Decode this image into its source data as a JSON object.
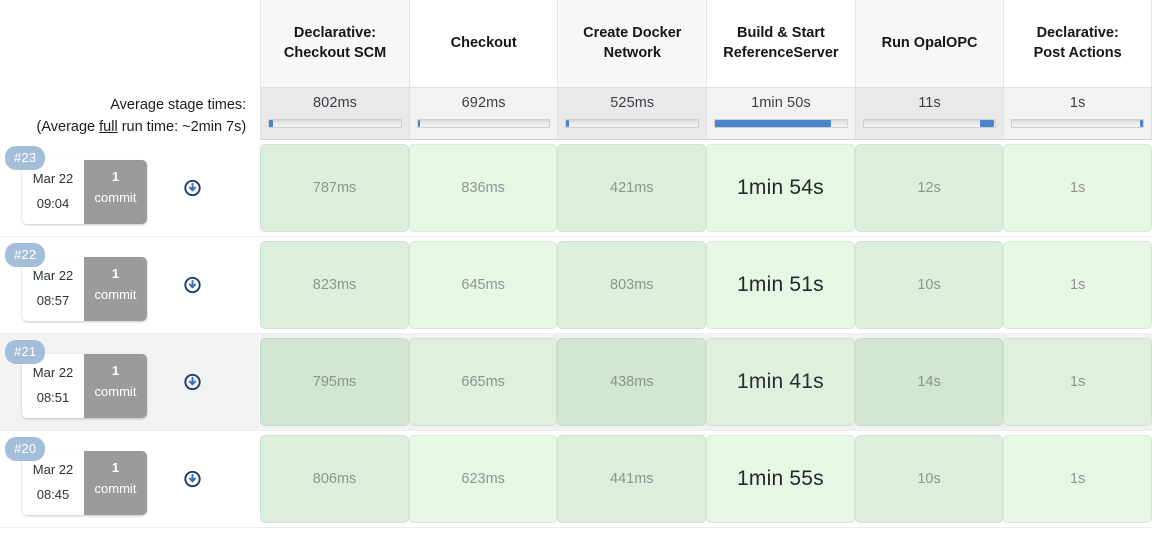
{
  "theme": {
    "badge_blue": "#a4bed9",
    "progress_blue": "#4a84cf",
    "commit_gray": "#9b9b9b",
    "cell_green": "#dcefdc",
    "cell_green_light": "#e6f7e3",
    "cell_green_hover": "#d2e7d2",
    "header_gray": "#f7f7f7",
    "avg_row_gray": "#e9e9e9"
  },
  "average": {
    "label_line1": "Average stage times:",
    "label_line2_pre": "(Average ",
    "label_line2_underlined": "full",
    "label_line2_post": " run time: ~2min 7s)"
  },
  "stages": [
    {
      "name": "Declarative: Checkout SCM",
      "name_line1": "Declarative:",
      "name_line2": "Checkout SCM",
      "average": "802ms",
      "bar_start_pct": 0,
      "bar_width_pct": 2.5,
      "header_alt": false
    },
    {
      "name": "Checkout",
      "name_line1": "Checkout",
      "name_line2": "",
      "average": "692ms",
      "bar_start_pct": 0,
      "bar_width_pct": 2.0,
      "header_alt": true
    },
    {
      "name": "Create Docker Network",
      "name_line1": "Create Docker",
      "name_line2": "Network",
      "average": "525ms",
      "bar_start_pct": 0,
      "bar_width_pct": 1.6,
      "header_alt": false
    },
    {
      "name": "Build & Start ReferenceServer",
      "name_line1": "Build & Start",
      "name_line2": "ReferenceServer",
      "average": "1min 50s",
      "bar_start_pct": 0,
      "bar_width_pct": 88,
      "header_alt": true
    },
    {
      "name": "Run OpalOPC",
      "name_line1": "Run OpalOPC",
      "name_line2": "",
      "average": "11s",
      "bar_start_pct": 88,
      "bar_width_pct": 11,
      "header_alt": false
    },
    {
      "name": "Declarative: Post Actions",
      "name_line1": "Declarative:",
      "name_line2": "Post Actions",
      "average": "1s",
      "bar_start_pct": 97.5,
      "bar_width_pct": 2.2,
      "header_alt": true
    }
  ],
  "builds": [
    {
      "number": "#23",
      "date": "Mar 22",
      "time": "09:04",
      "commit_count": "1",
      "commit_label": "commit",
      "history_icon": "download-circle-icon",
      "highlighted": false,
      "cells": [
        {
          "duration": "787ms",
          "big": false,
          "shade": "mid"
        },
        {
          "duration": "836ms",
          "big": false,
          "shade": "light"
        },
        {
          "duration": "421ms",
          "big": false,
          "shade": "mid"
        },
        {
          "duration": "1min 54s",
          "big": true,
          "shade": "light"
        },
        {
          "duration": "12s",
          "big": false,
          "shade": "mid"
        },
        {
          "duration": "1s",
          "big": false,
          "shade": "light"
        }
      ]
    },
    {
      "number": "#22",
      "date": "Mar 22",
      "time": "08:57",
      "commit_count": "1",
      "commit_label": "commit",
      "history_icon": "download-circle-icon",
      "highlighted": false,
      "cells": [
        {
          "duration": "823ms",
          "big": false,
          "shade": "mid"
        },
        {
          "duration": "645ms",
          "big": false,
          "shade": "light"
        },
        {
          "duration": "803ms",
          "big": false,
          "shade": "mid"
        },
        {
          "duration": "1min 51s",
          "big": true,
          "shade": "light"
        },
        {
          "duration": "10s",
          "big": false,
          "shade": "mid"
        },
        {
          "duration": "1s",
          "big": false,
          "shade": "light"
        }
      ]
    },
    {
      "number": "#21",
      "date": "Mar 22",
      "time": "08:51",
      "commit_count": "1",
      "commit_label": "commit",
      "history_icon": "download-circle-icon",
      "highlighted": true,
      "cells": [
        {
          "duration": "795ms",
          "big": false,
          "shade": "hover"
        },
        {
          "duration": "665ms",
          "big": false,
          "shade": "hoverlight"
        },
        {
          "duration": "438ms",
          "big": false,
          "shade": "hover"
        },
        {
          "duration": "1min 41s",
          "big": true,
          "shade": "hoverlight"
        },
        {
          "duration": "14s",
          "big": false,
          "shade": "hover"
        },
        {
          "duration": "1s",
          "big": false,
          "shade": "hoverlight"
        }
      ]
    },
    {
      "number": "#20",
      "date": "Mar 22",
      "time": "08:45",
      "commit_count": "1",
      "commit_label": "commit",
      "history_icon": "download-circle-icon",
      "highlighted": false,
      "cells": [
        {
          "duration": "806ms",
          "big": false,
          "shade": "mid"
        },
        {
          "duration": "623ms",
          "big": false,
          "shade": "light"
        },
        {
          "duration": "441ms",
          "big": false,
          "shade": "mid"
        },
        {
          "duration": "1min 55s",
          "big": true,
          "shade": "light"
        },
        {
          "duration": "10s",
          "big": false,
          "shade": "mid"
        },
        {
          "duration": "1s",
          "big": false,
          "shade": "light"
        }
      ]
    }
  ]
}
